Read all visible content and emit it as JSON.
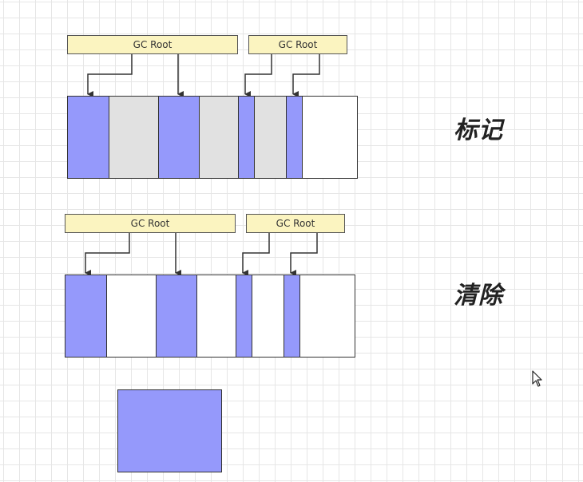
{
  "stages": [
    {
      "label": "标记",
      "roots": [
        "GC Root",
        "GC Root"
      ],
      "cells": [
        "live",
        "dead",
        "live",
        "dead",
        "live",
        "dead",
        "live",
        "free"
      ]
    },
    {
      "label": "清除",
      "roots": [
        "GC Root",
        "GC Root"
      ],
      "cells": [
        "live",
        "free",
        "live",
        "free",
        "live",
        "free",
        "live",
        "free"
      ]
    }
  ],
  "colors": {
    "live": "#9599fb",
    "dead": "#e1e1e1",
    "free": "#ffffff",
    "root_fill": "#fbf4c0"
  },
  "icons": {
    "cursor": "mouse-pointer-icon"
  }
}
